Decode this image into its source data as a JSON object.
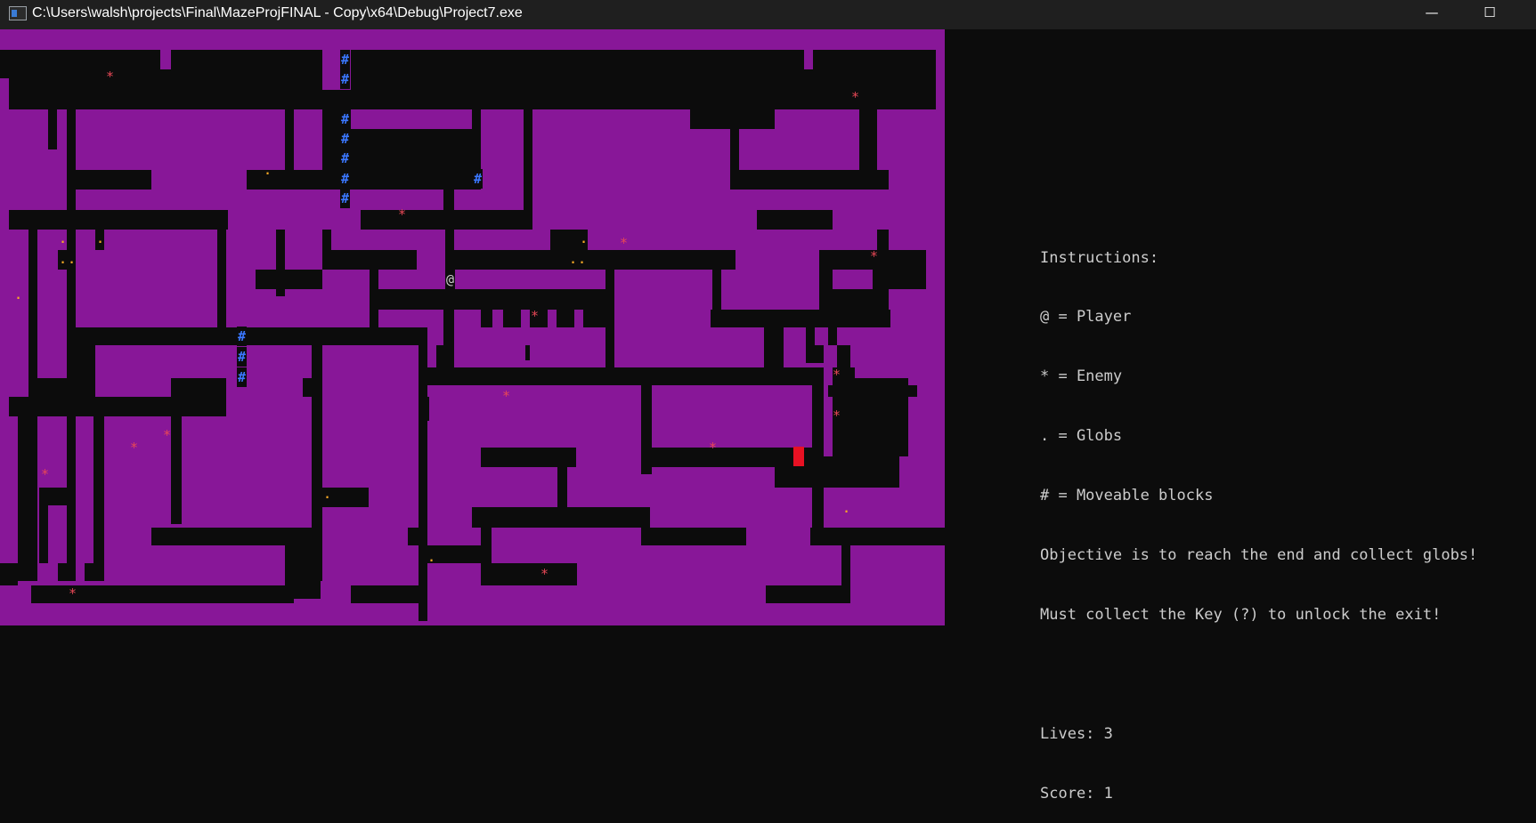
{
  "window": {
    "title": "C:\\Users\\walsh\\projects\\Final\\MazeProjFINAL - Copy\\x64\\Debug\\Project7.exe",
    "minimize_glyph": "—",
    "maximize_glyph": "☐"
  },
  "colors": {
    "console_background": "#0c0c0c",
    "maze_floor": "#881798",
    "wall": "#0c0c0c",
    "enemy": "#e74856",
    "glob": "#f9a825",
    "block": "#3b78ff",
    "player": "#cccccc",
    "exit": "#e81123",
    "text": "#cccccc"
  },
  "game": {
    "player_symbol": "@",
    "enemy_symbol": "*",
    "glob_symbol": ".",
    "block_symbol": "#",
    "enemy_count": 15,
    "glob_count": 12,
    "block_count": 11
  },
  "info": {
    "heading": "Instructions:",
    "player_line": "@ = Player",
    "enemy_line": "* = Enemy",
    "glob_line": ". = Globs",
    "block_line": "# = Moveable blocks",
    "objective": "Objective is to reach the end and collect globs!",
    "key_hint": "Must collect the Key (?) to unlock the exit!",
    "lives_label": "Lives: ",
    "lives": 3,
    "score_label": "Score: ",
    "score": 1
  }
}
